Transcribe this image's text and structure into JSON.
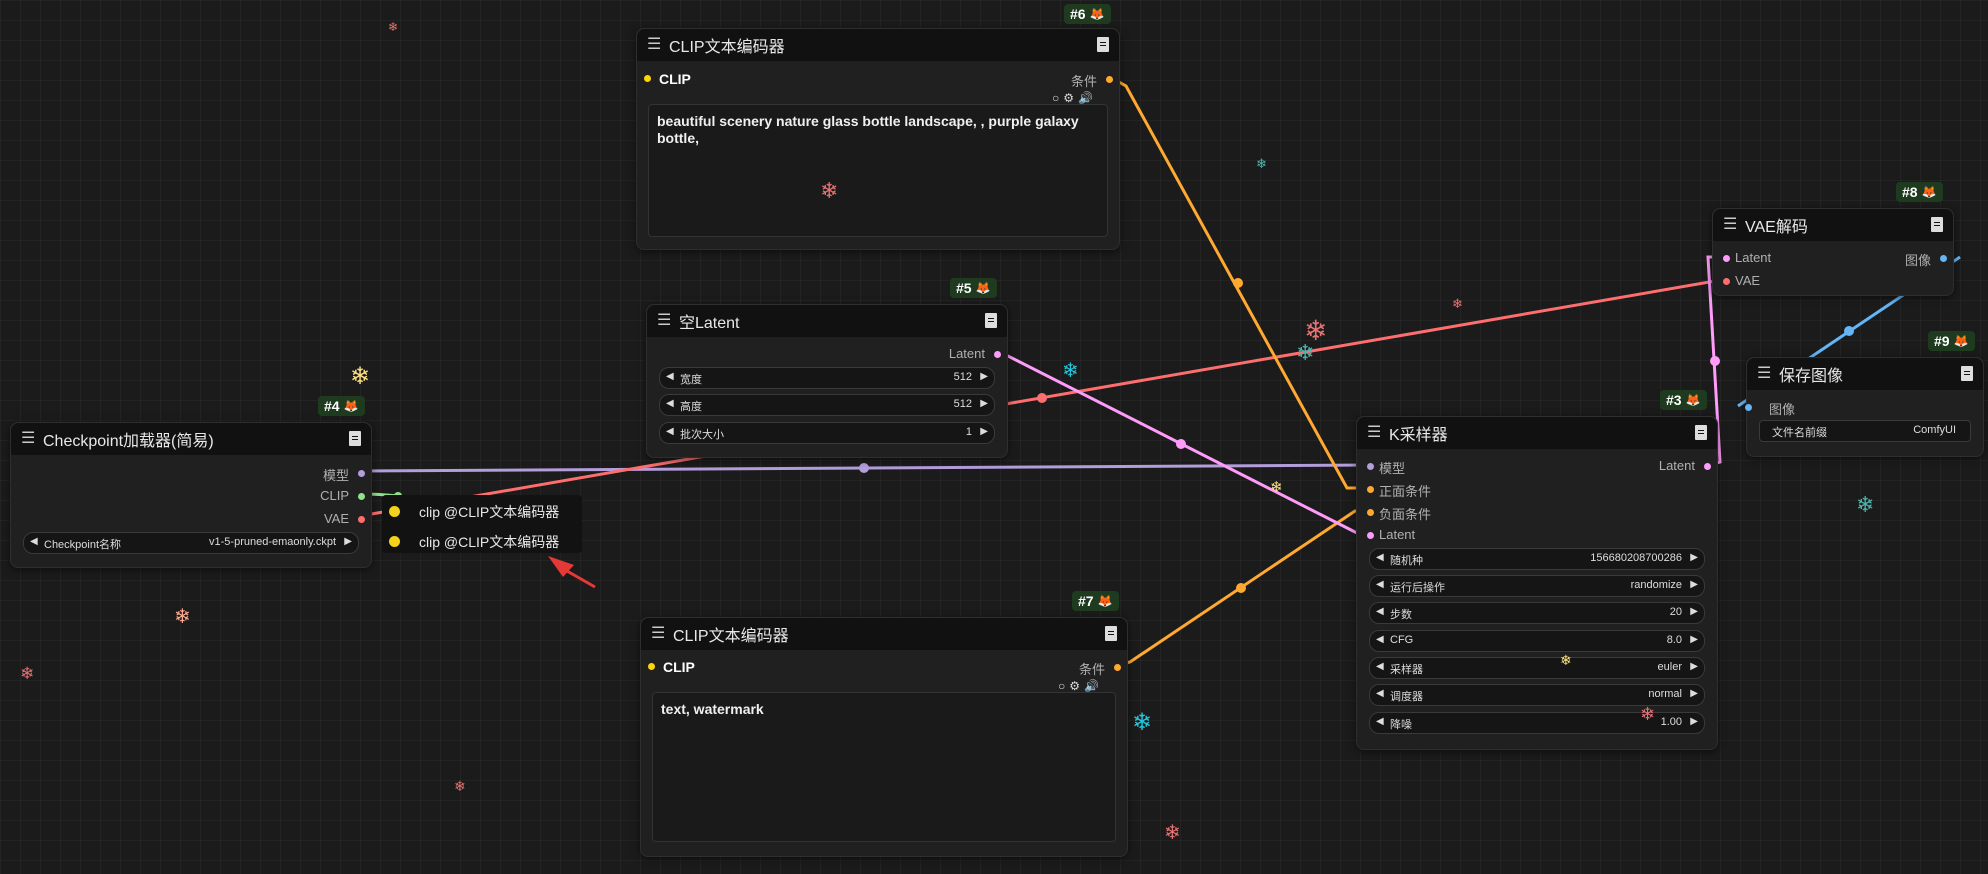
{
  "colors": {
    "model_wire": "#b39ddb",
    "clip_wire": "#ffd500",
    "vae_wire": "#ff6e6e",
    "conditioning_wire": "#ffa931",
    "latent_wire": "#ff9cf9",
    "image_wire": "#64b5f6",
    "clip_dot": "#ffd500",
    "badge_bg": "#1e3a1f"
  },
  "nodes": {
    "clip_text_encoder_pos": {
      "id": "#6",
      "title": "CLIP文本编码器",
      "input_clip": "CLIP",
      "output": "条件",
      "text": "beautiful scenery nature glass bottle landscape, , purple galaxy bottle,"
    },
    "empty_latent": {
      "id": "#5",
      "title": "空Latent",
      "output": "Latent",
      "widgets": [
        {
          "label": "宽度",
          "value": "512"
        },
        {
          "label": "高度",
          "value": "512"
        },
        {
          "label": "批次大小",
          "value": "1"
        }
      ]
    },
    "checkpoint_loader": {
      "id": "#4",
      "title": "Checkpoint加载器(简易)",
      "outputs": [
        "模型",
        "CLIP",
        "VAE"
      ],
      "widget": {
        "label": "Checkpoint名称",
        "value": "v1-5-pruned-emaonly.ckpt"
      }
    },
    "clip_text_encoder_neg": {
      "id": "#7",
      "title": "CLIP文本编码器",
      "input_clip": "CLIP",
      "output": "条件",
      "text": "text, watermark"
    },
    "ksampler": {
      "id": "#3",
      "title": "K采样器",
      "inputs": [
        "模型",
        "正面条件",
        "负面条件",
        "Latent"
      ],
      "output": "Latent",
      "widgets": [
        {
          "label": "随机种",
          "value": "156680208700286"
        },
        {
          "label": "运行后操作",
          "value": "randomize"
        },
        {
          "label": "步数",
          "value": "20"
        },
        {
          "label": "CFG",
          "value": "8.0"
        },
        {
          "label": "采样器",
          "value": "euler"
        },
        {
          "label": "调度器",
          "value": "normal"
        },
        {
          "label": "降噪",
          "value": "1.00"
        }
      ]
    },
    "vae_decode": {
      "id": "#8",
      "title": "VAE解码",
      "inputs": [
        "Latent",
        "VAE"
      ],
      "output": "图像"
    },
    "save_image": {
      "id": "#9",
      "title": "保存图像",
      "input": "图像",
      "widget": {
        "label": "文件名前缀",
        "value": "ComfyUI"
      }
    }
  },
  "tooltip": {
    "items": [
      "clip @CLIP文本编码器",
      "clip @CLIP文本编码器"
    ]
  }
}
